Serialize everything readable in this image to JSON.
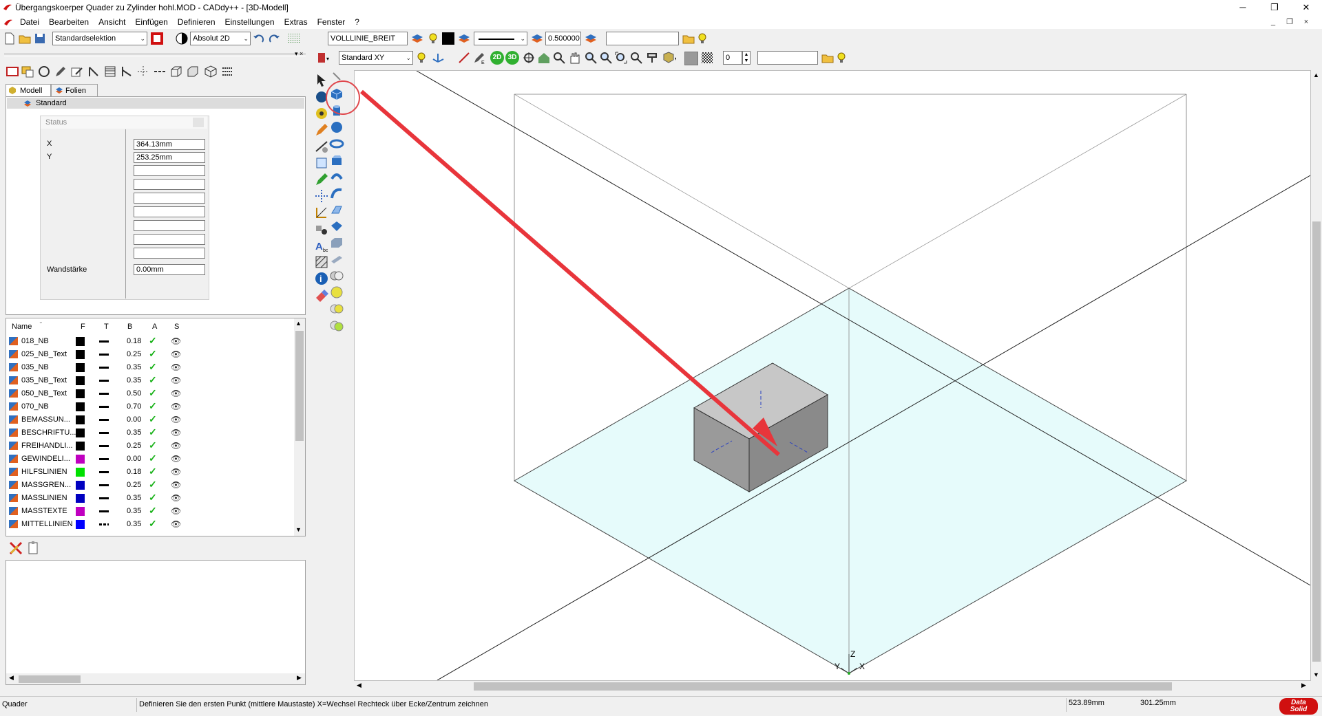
{
  "window": {
    "title": "Übergangskoerper Quader zu Zylinder hohl.MOD  -  CADdy++ - [3D-Modell]",
    "controls": [
      "─",
      "❐",
      "✕"
    ]
  },
  "menu": [
    "Datei",
    "Bearbeiten",
    "Ansicht",
    "Einfügen",
    "Definieren",
    "Einstellungen",
    "Extras",
    "Fenster",
    "?"
  ],
  "mdi_controls": [
    "_",
    "❐",
    "×"
  ],
  "toolbar1": {
    "selection_mode": "Standardselektion",
    "coord_mode": "Absolut 2D",
    "linetype": "VOLLLINIE_BREIT",
    "linewidth": "0.500000",
    "empty_field": ""
  },
  "toolbar2": {
    "view": "Standard XY",
    "btn_2d": "2D",
    "btn_3d": "3D",
    "number": "0",
    "empty_field": ""
  },
  "panel": {
    "tabs": [
      "Modell",
      "Folien"
    ],
    "tree_root": "Standard",
    "status_title": "Status",
    "x_label": "X",
    "x_value": "364.13mm",
    "y_label": "Y",
    "y_value": "253.25mm",
    "wall_label": "Wandstärke",
    "wall_value": "0.00mm"
  },
  "layers": {
    "headers": [
      "Name",
      "F",
      "T",
      "B",
      "A",
      "S"
    ],
    "rows": [
      {
        "name": "018_NB",
        "color": "#000000",
        "weight": "0.18"
      },
      {
        "name": "025_NB_Text",
        "color": "#000000",
        "weight": "0.25"
      },
      {
        "name": "035_NB",
        "color": "#000000",
        "weight": "0.35"
      },
      {
        "name": "035_NB_Text",
        "color": "#000000",
        "weight": "0.35"
      },
      {
        "name": "050_NB_Text",
        "color": "#000000",
        "weight": "0.50"
      },
      {
        "name": "070_NB",
        "color": "#000000",
        "weight": "0.70"
      },
      {
        "name": "BEMASSUN...",
        "color": "#000000",
        "weight": "0.00"
      },
      {
        "name": "BESCHRIFTU...",
        "color": "#000000",
        "weight": "0.35"
      },
      {
        "name": "FREIHANDLI...",
        "color": "#000000",
        "weight": "0.25"
      },
      {
        "name": "GEWINDELI...",
        "color": "#c000c0",
        "weight": "0.00"
      },
      {
        "name": "HILFSLINIEN",
        "color": "#00e000",
        "weight": "0.18"
      },
      {
        "name": "MASSGREN...",
        "color": "#0000c0",
        "weight": "0.25"
      },
      {
        "name": "MASSLINIEN",
        "color": "#0000c0",
        "weight": "0.35"
      },
      {
        "name": "MASSTEXTE",
        "color": "#c000c0",
        "weight": "0.35"
      },
      {
        "name": "MITTELLINIEN",
        "color": "#0000ff",
        "weight": "0.35"
      }
    ]
  },
  "axes": {
    "x": "X",
    "y": "Y",
    "z": "Z"
  },
  "statusbar": {
    "command": "Quader",
    "prompt": "Definieren Sie den ersten Punkt (mittlere Maustaste) X=Wechsel Rechteck über Ecke/Zentrum zeichnen",
    "coord_x": "523.89mm",
    "coord_y": "301.25mm",
    "logo_line1": "Data",
    "logo_line2": "Solid"
  },
  "colors": {
    "ground_plane": "#e6fbfb",
    "arrow": "#e8353b",
    "highlight_circle": "#e0474c",
    "box_top": "#c7c7c7",
    "box_front": "#9a9a9a",
    "box_side": "#8a8a8a"
  }
}
